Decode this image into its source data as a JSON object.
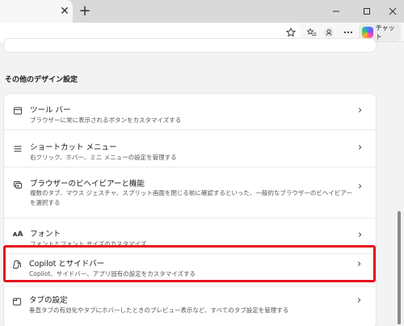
{
  "window": {
    "tab_close_glyph": "✕",
    "new_tab_glyph": "+",
    "minimize_glyph": "—",
    "maximize_glyph": "☐",
    "close_glyph": "✕"
  },
  "toolbar": {
    "chat_label": "チャット"
  },
  "section": {
    "title": "その他のデザイン設定"
  },
  "items": [
    {
      "icon": "toolbar-icon",
      "title": "ツール バー",
      "desc": "ブラウザーに常に表示されるボタンをカスタマイズする"
    },
    {
      "icon": "menu-icon",
      "title": "ショートカット メニュー",
      "desc": "右クリック、ホバー、ミニ メニューの設定を管理する"
    },
    {
      "icon": "browser-behavior-icon",
      "title": "ブラウザーのビヘイビアーと機能",
      "desc": "複数のタブ、マウス ジェスチャ、スプリット画面を閉じる前に確認するといった、一般的なブラウザーのビヘイビアーを選択する"
    },
    {
      "icon": "font-icon",
      "title": "フォント",
      "desc": "フォントとフォント サイズのカスタマイズ"
    },
    {
      "icon": "copilot-icon",
      "title": "Copilot とサイドバー",
      "desc": "Copilot、サイドバー、アプリ固有の設定をカスタマイズする"
    },
    {
      "icon": "tabs-icon",
      "title": "タブの設定",
      "desc": "垂直タブの有効化やタブにホバーしたときのプレビュー表示など、すべてのタブ設定を管理する"
    }
  ],
  "colors": {
    "highlight": "#e3101d"
  }
}
